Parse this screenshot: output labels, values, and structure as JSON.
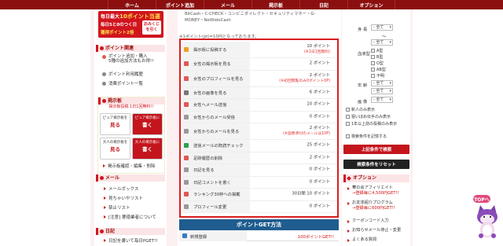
{
  "nav": {
    "items": [
      "ホーム",
      "ポイント追加",
      "メール",
      "掲示板",
      "日記",
      "オプション"
    ]
  },
  "promo": {
    "top_prefix": "毎日最大",
    "top_highlight": "10ポイント当選",
    "line1": "毎日5と0のつく日",
    "line2": "獲得ポイント2倍",
    "button": "おみくじを引く"
  },
  "left": {
    "points_head": "ポイント関連",
    "points_items": [
      "ポイント追加・購入\n5種の追加方法もお得!!",
      "ポイント利用履歴",
      "消費ポイント一覧"
    ],
    "bbs_head": "掲示板",
    "bbs_note": "掲示板投稿 1日1回無料!!",
    "cards": [
      {
        "small": "ピュア掲示板を",
        "big": "見る"
      },
      {
        "small": "ピュア掲示板に",
        "big": "書く"
      },
      {
        "small": "大人の掲示板を",
        "big": "見る"
      },
      {
        "small": "大人の掲示板に",
        "big": "書く"
      }
    ],
    "bbs_link": "掲示板確認・編集・削除",
    "mail_head": "メール",
    "mail_items": [
      "メールボックス",
      "見ちゃいやリスト",
      "禁止リスト",
      "[注意] 悪徳業者について"
    ],
    "diary_head": "日記",
    "diary_item": "日記を書いて毎日PGET!!"
  },
  "center": {
    "top_note": "BitCash・C-CHECK・コンビニダイレクト・セキュリティマネー・G-MONEY・NetRideCash",
    "footnote": "※1ポイント(pt)=10円となっております。",
    "rows": [
      {
        "label": "掲示板に投稿する",
        "value": "10 ポイント",
        "sub": "(※1日1回無料)"
      },
      {
        "label": "女性の掲示板を見る",
        "value": "2 ポイント",
        "sub": ""
      },
      {
        "label": "女性のプロフィールを見る",
        "value": "2 ポイント",
        "sub": "(※初回閲覧のみ0ポイント0P)"
      },
      {
        "label": "女性の画像を見る",
        "value": "6 ポイント",
        "sub": ""
      },
      {
        "label": "女性へメール送信",
        "value": "10 ポイント",
        "sub": ""
      },
      {
        "label": "女性からのメール受信",
        "value": "0 ポイント",
        "sub": ""
      },
      {
        "label": "女性からのメールを見る",
        "value": "2 ポイント",
        "sub": "(※画像添付のメールは10P)"
      },
      {
        "label": "送信メールの既読チェック",
        "value": "25 ポイント",
        "sub": ""
      },
      {
        "label": "足跡履歴の削除",
        "value": "2 ポイント",
        "sub": ""
      },
      {
        "label": "日記を見る",
        "value": "0 ポイント",
        "sub": ""
      },
      {
        "label": "日記コメントを書く",
        "value": "0 ポイント",
        "sub": ""
      },
      {
        "label": "ランキング30枠への掲載",
        "value": "30日間 10 ポイント",
        "sub": ""
      },
      {
        "label": "プロフィール変更",
        "value": "0 ポイント",
        "sub": ""
      }
    ],
    "get_title": "ポイントGET方法",
    "get_row": {
      "label": "新規登録",
      "value": "100ポイントGET!!"
    }
  },
  "right": {
    "height_label": "身 長",
    "height_value": "- 全て",
    "tilde": "〜",
    "height_value2": "- 全て",
    "blood_label": "血液型",
    "blood_options": [
      "A型",
      "B型",
      "O型",
      "AB型",
      "不明"
    ],
    "age_label": "年 齢",
    "age_value": "- 全て",
    "age_value2": "- 全て",
    "image_label": "画 像",
    "image_value": "- 全て",
    "checks": [
      "新人のみ表示",
      "狙いぼめ伝手のみ表示",
      "1年以上前の投稿のみ表示"
    ],
    "save_check": "検索条件を記憶する",
    "search_btn": "上記条件で検索",
    "reset_btn": "検索条件をリセット",
    "colors": {
      "search": "#c4151d",
      "reset": "#222222"
    }
  },
  "options": {
    "head": "オプション",
    "items": [
      {
        "text": "華の会アフィリエイト",
        "red": "→登録毎に4,500円GET!!"
      },
      {
        "text": "お友達紹介プログラム",
        "red": "→登録毎に600円GET!!"
      },
      {
        "text": "クーポンコード入力",
        "red": ""
      },
      {
        "text": "お知らせメール停止・変更",
        "red": ""
      },
      {
        "text": "よくある質問",
        "red": ""
      }
    ]
  },
  "top_button": "TOPへ"
}
